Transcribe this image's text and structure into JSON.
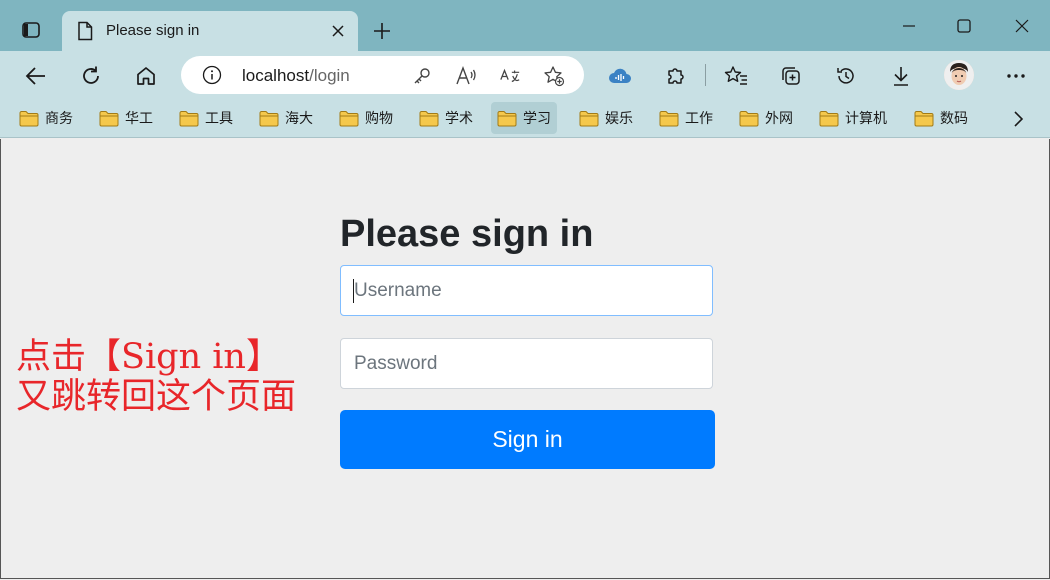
{
  "tab": {
    "title": "Please sign in"
  },
  "address_bar": {
    "host": "localhost",
    "path": "/login"
  },
  "bookmarks": [
    "商务",
    "华工",
    "工具",
    "海大",
    "购物",
    "学术",
    "学习",
    "娱乐",
    "工作",
    "外网",
    "计算机",
    "数码"
  ],
  "active_bookmark": "学习",
  "form": {
    "heading": "Please sign in",
    "username_placeholder": "Username",
    "password_placeholder": "Password",
    "submit_label": "Sign in"
  },
  "annotation": {
    "line1": "点击【Sign in】",
    "line2": "又跳转回这个页面"
  },
  "colors": {
    "frame": "#7fb5c0",
    "toolbar": "#c8e0e4",
    "primary": "#007bff",
    "annotation": "#e8262a"
  }
}
